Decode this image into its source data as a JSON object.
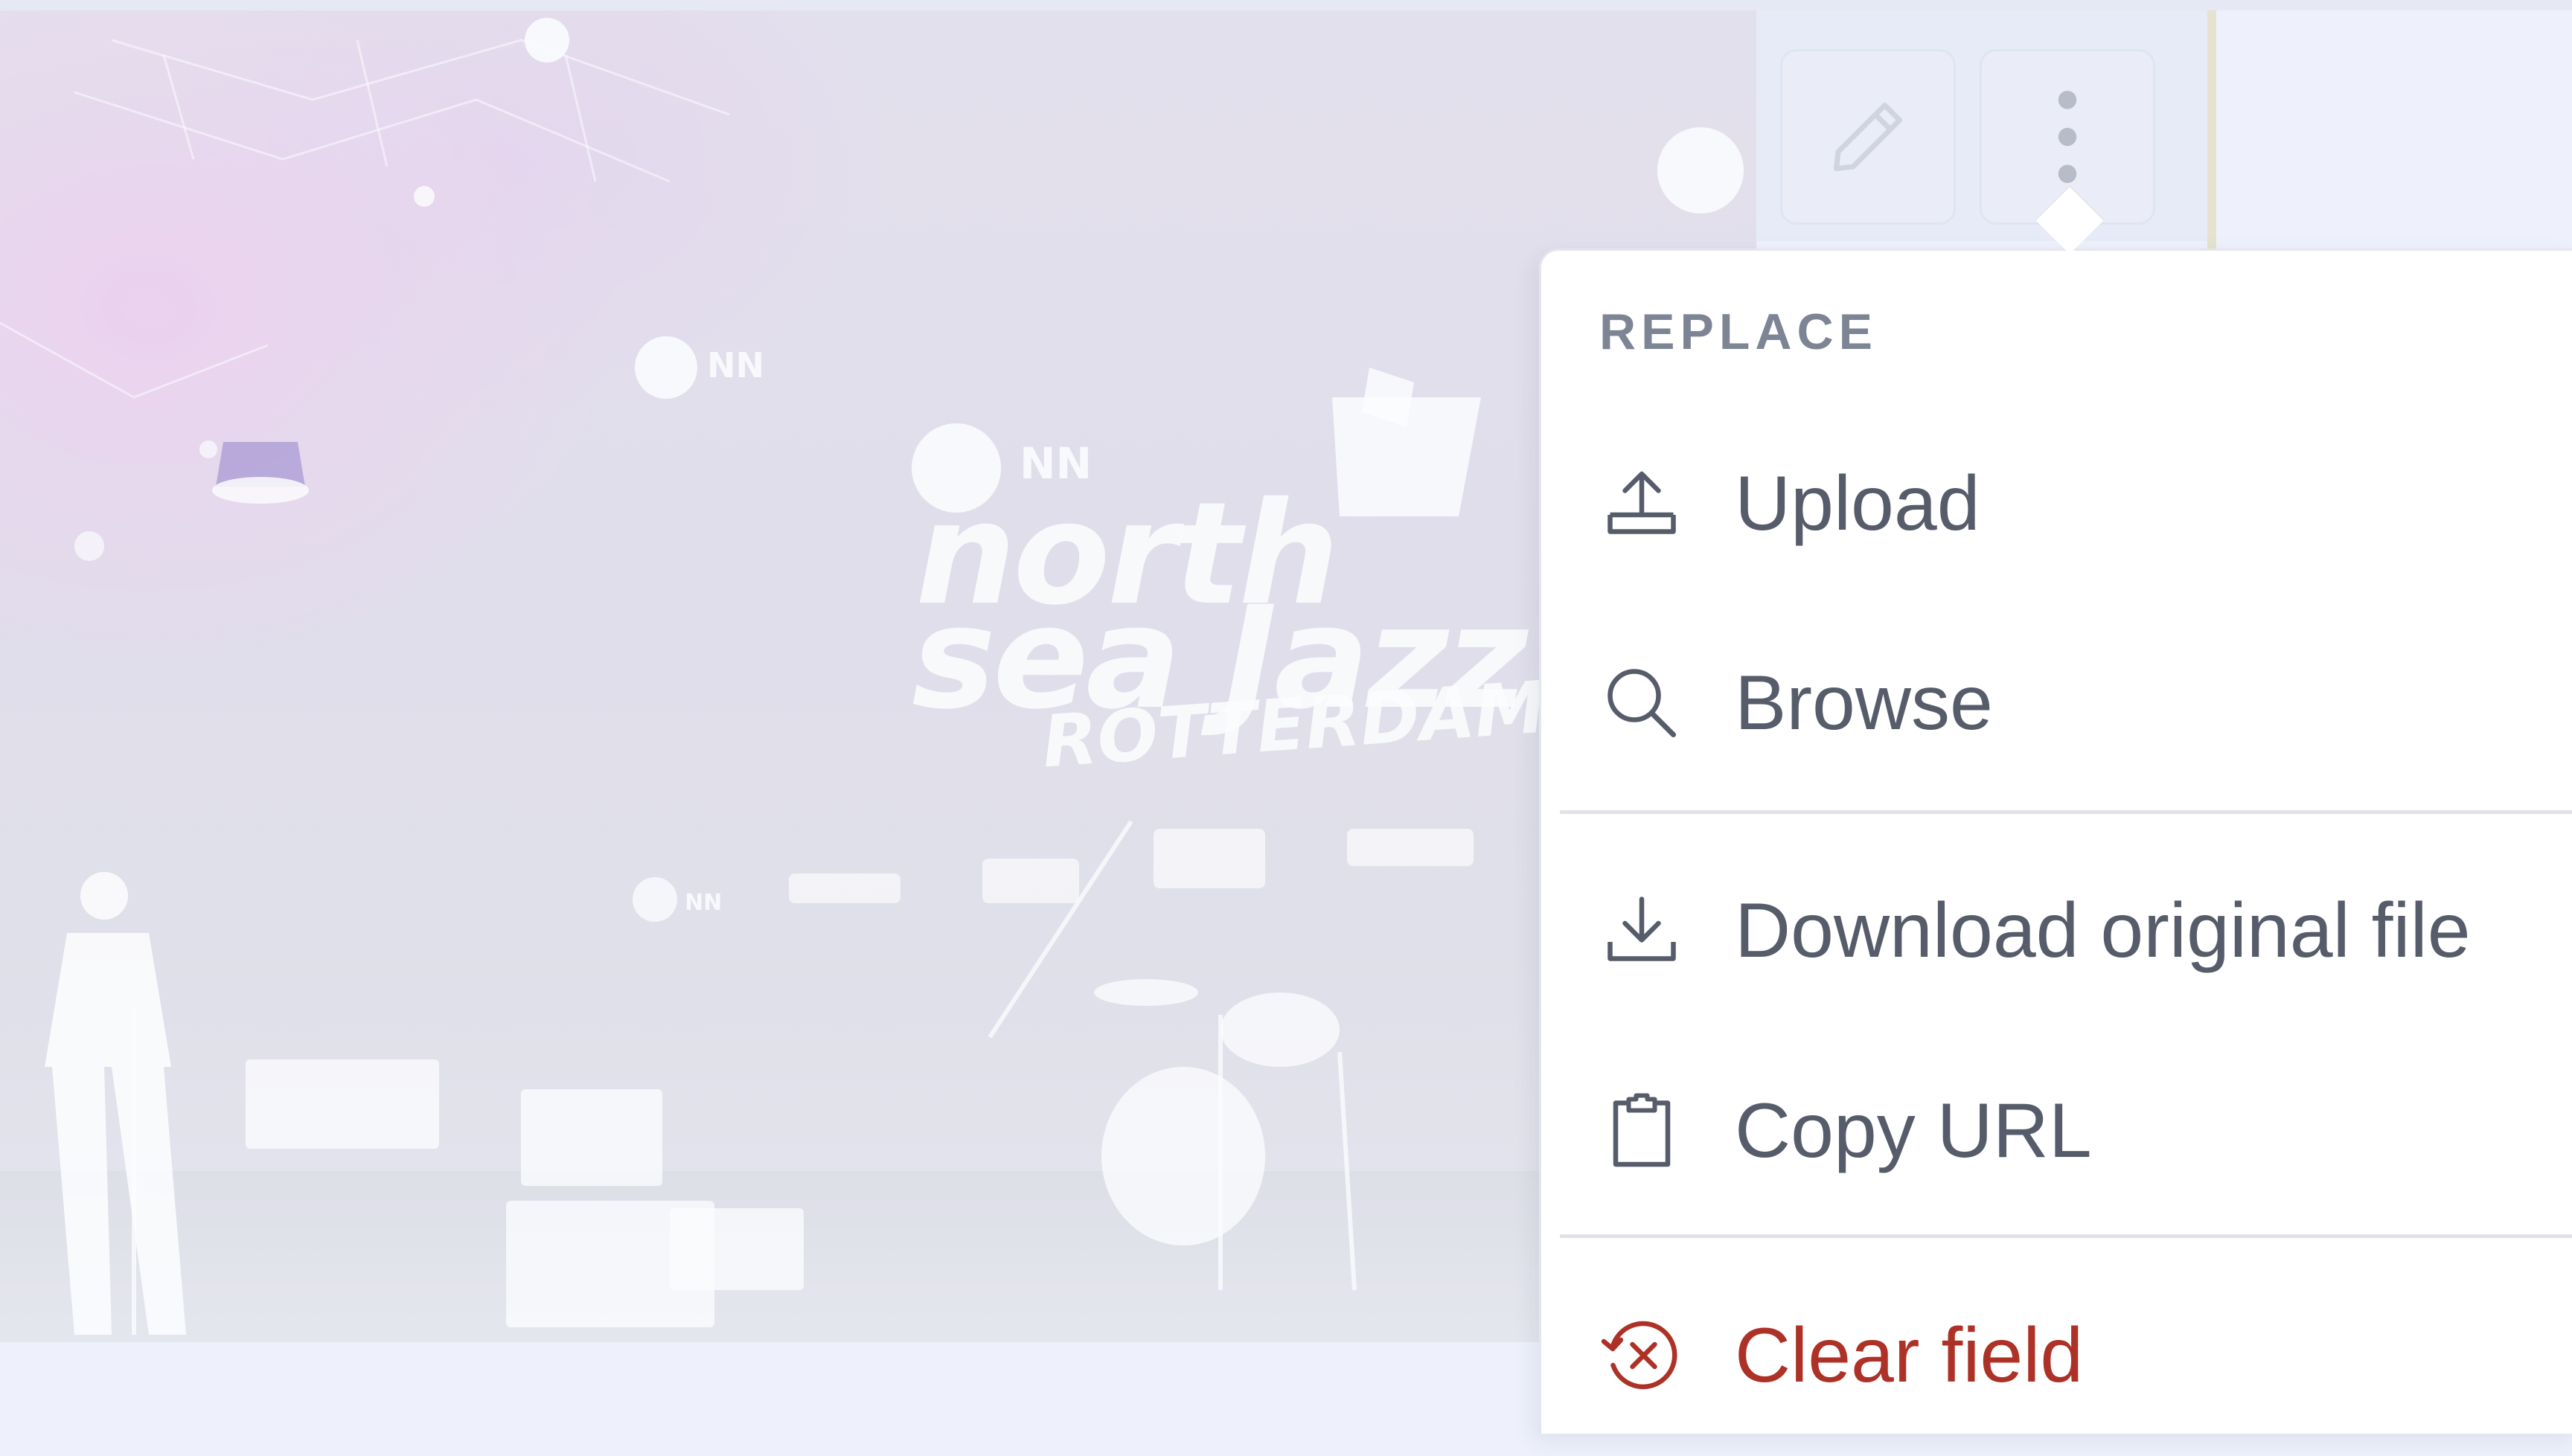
{
  "toolbar": {
    "edit_icon": "pencil-icon",
    "more_icon": "vertical-ellipsis-icon"
  },
  "preview": {
    "brand_lines": [
      "north",
      "sea Jazz",
      "ROTTERDAM"
    ],
    "sponsor_mark": "NN"
  },
  "menu": {
    "section_label": "REPLACE",
    "items": [
      {
        "label": "Upload",
        "icon": "upload-icon"
      },
      {
        "label": "Browse",
        "icon": "search-icon"
      },
      {
        "label": "Download original file",
        "icon": "download-icon"
      },
      {
        "label": "Copy URL",
        "icon": "clipboard-icon"
      },
      {
        "label": "Clear field",
        "icon": "clear-field-icon"
      }
    ]
  },
  "colors": {
    "page_background": "#eef1fb",
    "menu_text": "#565c69",
    "section_label": "#7d8595",
    "danger": "#ad3127",
    "divider": "#dfe2e8"
  }
}
